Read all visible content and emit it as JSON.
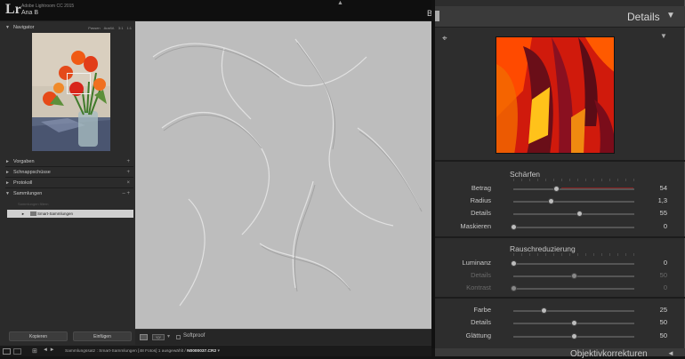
{
  "app": {
    "logo": "Lr",
    "name": "Adobe Lightroom CC 2015",
    "user": "Ana B",
    "b_mark": "B"
  },
  "left_panel": {
    "navigator": {
      "title": "Navigator",
      "zoom": [
        "Passen",
        "Ausfül.",
        "3:1",
        "1:1"
      ]
    },
    "sections": [
      {
        "title": "Vorgaben",
        "plus": "+"
      },
      {
        "title": "Schnappschüsse",
        "plus": "+"
      },
      {
        "title": "Protokoll",
        "plus": "×"
      },
      {
        "title": "Sammlungen",
        "plus": "– +"
      }
    ],
    "collections": {
      "filter_placeholder": "Sammlungen filtern",
      "item": "Smart-Sammlungen"
    },
    "copy_button": "Kopieren",
    "paste_button": "Einfügen"
  },
  "toolbar": {
    "softproof": "Softproof",
    "caret": "▾"
  },
  "status_bar": {
    "prefix": "Sammlungssatz : Smart-Sammlungen   [48 Fotos]   1 ausgewählt /",
    "file": "N0000037.CR2",
    "suffix": " ▾"
  },
  "right_panel": {
    "title": "Details",
    "sharpening": {
      "title": "Schärfen",
      "rows": [
        {
          "label": "Betrag",
          "value": "54",
          "pos": 0.36
        },
        {
          "label": "Radius",
          "value": "1,3",
          "pos": 0.31
        },
        {
          "label": "Details",
          "value": "55",
          "pos": 0.55
        },
        {
          "label": "Maskieren",
          "value": "0",
          "pos": 0.0
        }
      ]
    },
    "noise": {
      "title": "Rauschreduzierung",
      "rows": [
        {
          "label": "Luminanz",
          "value": "0",
          "pos": 0.0,
          "dim": false
        },
        {
          "label": "Details",
          "value": "50",
          "pos": 0.5,
          "dim": true
        },
        {
          "label": "Kontrast",
          "value": "0",
          "pos": 0.0,
          "dim": true
        }
      ],
      "color_rows": [
        {
          "label": "Farbe",
          "value": "25",
          "pos": 0.25
        },
        {
          "label": "Details",
          "value": "50",
          "pos": 0.5
        },
        {
          "label": "Glättung",
          "value": "50",
          "pos": 0.5
        }
      ]
    },
    "footer": "Objektivkorrekturen"
  }
}
